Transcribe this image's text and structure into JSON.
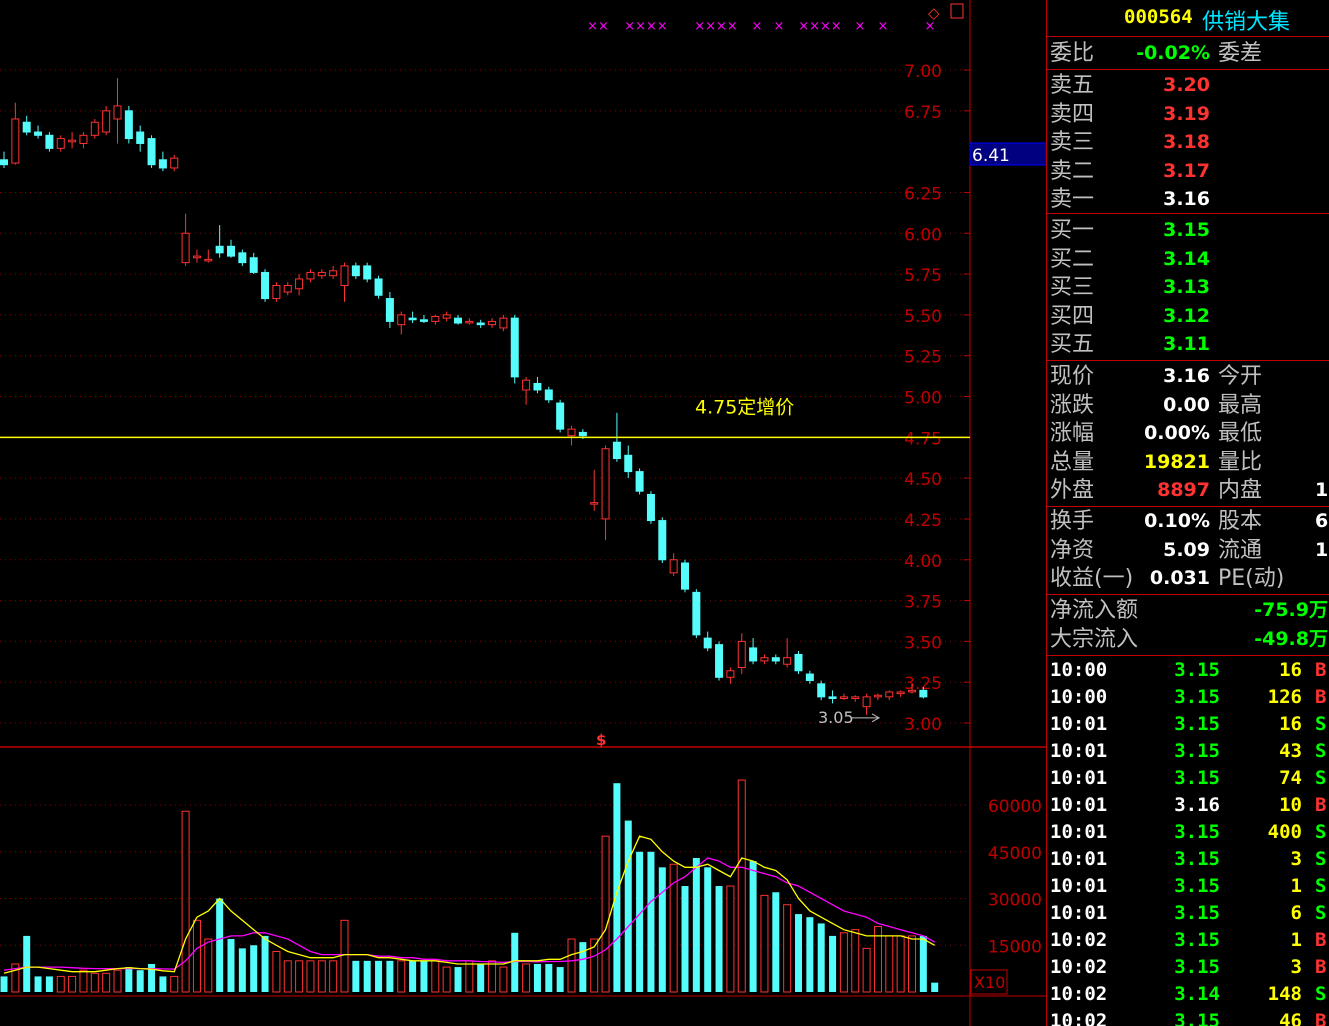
{
  "stock": {
    "code": "000564",
    "name": "供销大集"
  },
  "price_axis": [
    {
      "label": "7.00",
      "v": 7.0
    },
    {
      "label": "6.75",
      "v": 6.75
    },
    {
      "label": "6.25",
      "v": 6.25
    },
    {
      "label": "6.00",
      "v": 6.0
    },
    {
      "label": "5.75",
      "v": 5.75
    },
    {
      "label": "5.50",
      "v": 5.5
    },
    {
      "label": "5.25",
      "v": 5.25
    },
    {
      "label": "5.00",
      "v": 5.0
    },
    {
      "label": "4.75",
      "v": 4.75
    },
    {
      "label": "4.50",
      "v": 4.5
    },
    {
      "label": "4.25",
      "v": 4.25
    },
    {
      "label": "4.00",
      "v": 4.0
    },
    {
      "label": "3.75",
      "v": 3.75
    },
    {
      "label": "3.50",
      "v": 3.5
    },
    {
      "label": "3.25",
      "v": 3.25
    },
    {
      "label": "3.00",
      "v": 3.0
    }
  ],
  "current_price_tag": "6.41",
  "ref_line": {
    "label": "4.75定增价",
    "value": 4.75
  },
  "low_marker": "3.05",
  "dollar_marker": "$",
  "volume_axis": [
    {
      "label": "60000",
      "v": 60000
    },
    {
      "label": "45000",
      "v": 45000
    },
    {
      "label": "30000",
      "v": 30000
    },
    {
      "label": "15000",
      "v": 15000
    }
  ],
  "volume_unit": "X10",
  "top_markers": [
    "××",
    "××××",
    "××××",
    "×",
    "×",
    "××××",
    "×",
    "×",
    "×"
  ],
  "colors": {
    "up": "#ff3232",
    "down": "#54fcfc",
    "grid": "#8b0000",
    "ref": "#ffff00",
    "ma_yellow": "#ffff00",
    "ma_magenta": "#ff00ff"
  },
  "chart_data": [
    {
      "type": "candlestick",
      "title": "",
      "ylim": [
        3.0,
        7.0
      ],
      "candles": [
        {
          "o": 6.45,
          "h": 6.5,
          "l": 6.4,
          "c": 6.42
        },
        {
          "o": 6.43,
          "h": 6.8,
          "l": 6.42,
          "c": 6.7
        },
        {
          "o": 6.68,
          "h": 6.72,
          "l": 6.6,
          "c": 6.62
        },
        {
          "o": 6.62,
          "h": 6.66,
          "l": 6.58,
          "c": 6.6
        },
        {
          "o": 6.6,
          "h": 6.62,
          "l": 6.5,
          "c": 6.52
        },
        {
          "o": 6.52,
          "h": 6.6,
          "l": 6.5,
          "c": 6.58
        },
        {
          "o": 6.56,
          "h": 6.62,
          "l": 6.52,
          "c": 6.57
        },
        {
          "o": 6.55,
          "h": 6.62,
          "l": 6.52,
          "c": 6.6
        },
        {
          "o": 6.6,
          "h": 6.7,
          "l": 6.58,
          "c": 6.68
        },
        {
          "o": 6.62,
          "h": 6.78,
          "l": 6.6,
          "c": 6.75
        },
        {
          "o": 6.7,
          "h": 6.95,
          "l": 6.55,
          "c": 6.78
        },
        {
          "o": 6.75,
          "h": 6.78,
          "l": 6.55,
          "c": 6.58
        },
        {
          "o": 6.62,
          "h": 6.66,
          "l": 6.5,
          "c": 6.55
        },
        {
          "o": 6.58,
          "h": 6.6,
          "l": 6.4,
          "c": 6.42
        },
        {
          "o": 6.45,
          "h": 6.5,
          "l": 6.38,
          "c": 6.4
        },
        {
          "o": 6.4,
          "h": 6.48,
          "l": 6.38,
          "c": 6.46
        },
        {
          "o": 5.82,
          "h": 6.12,
          "l": 5.8,
          "c": 6.0
        },
        {
          "o": 5.85,
          "h": 5.9,
          "l": 5.82,
          "c": 5.86
        },
        {
          "o": 5.84,
          "h": 5.9,
          "l": 5.82,
          "c": 5.84
        },
        {
          "o": 5.92,
          "h": 6.05,
          "l": 5.85,
          "c": 5.88
        },
        {
          "o": 5.92,
          "h": 5.96,
          "l": 5.85,
          "c": 5.86
        },
        {
          "o": 5.88,
          "h": 5.9,
          "l": 5.8,
          "c": 5.82
        },
        {
          "o": 5.85,
          "h": 5.88,
          "l": 5.75,
          "c": 5.76
        },
        {
          "o": 5.76,
          "h": 5.78,
          "l": 5.58,
          "c": 5.6
        },
        {
          "o": 5.6,
          "h": 5.7,
          "l": 5.58,
          "c": 5.68
        },
        {
          "o": 5.64,
          "h": 5.7,
          "l": 5.62,
          "c": 5.68
        },
        {
          "o": 5.66,
          "h": 5.75,
          "l": 5.62,
          "c": 5.72
        },
        {
          "o": 5.72,
          "h": 5.78,
          "l": 5.7,
          "c": 5.76
        },
        {
          "o": 5.74,
          "h": 5.78,
          "l": 5.72,
          "c": 5.76
        },
        {
          "o": 5.74,
          "h": 5.8,
          "l": 5.72,
          "c": 5.77
        },
        {
          "o": 5.68,
          "h": 5.82,
          "l": 5.58,
          "c": 5.8
        },
        {
          "o": 5.8,
          "h": 5.82,
          "l": 5.72,
          "c": 5.74
        },
        {
          "o": 5.8,
          "h": 5.82,
          "l": 5.7,
          "c": 5.72
        },
        {
          "o": 5.72,
          "h": 5.74,
          "l": 5.6,
          "c": 5.62
        },
        {
          "o": 5.6,
          "h": 5.64,
          "l": 5.42,
          "c": 5.46
        },
        {
          "o": 5.44,
          "h": 5.52,
          "l": 5.38,
          "c": 5.5
        },
        {
          "o": 5.48,
          "h": 5.52,
          "l": 5.45,
          "c": 5.47
        },
        {
          "o": 5.47,
          "h": 5.5,
          "l": 5.45,
          "c": 5.46
        },
        {
          "o": 5.46,
          "h": 5.5,
          "l": 5.44,
          "c": 5.49
        },
        {
          "o": 5.48,
          "h": 5.52,
          "l": 5.46,
          "c": 5.5
        },
        {
          "o": 5.48,
          "h": 5.5,
          "l": 5.44,
          "c": 5.45
        },
        {
          "o": 5.46,
          "h": 5.48,
          "l": 5.44,
          "c": 5.46
        },
        {
          "o": 5.45,
          "h": 5.47,
          "l": 5.42,
          "c": 5.44
        },
        {
          "o": 5.44,
          "h": 5.48,
          "l": 5.42,
          "c": 5.46
        },
        {
          "o": 5.42,
          "h": 5.5,
          "l": 5.4,
          "c": 5.48
        },
        {
          "o": 5.48,
          "h": 5.5,
          "l": 5.08,
          "c": 5.12
        },
        {
          "o": 5.04,
          "h": 5.12,
          "l": 4.95,
          "c": 5.1
        },
        {
          "o": 5.08,
          "h": 5.12,
          "l": 5.02,
          "c": 5.04
        },
        {
          "o": 5.04,
          "h": 5.06,
          "l": 4.96,
          "c": 4.98
        },
        {
          "o": 4.96,
          "h": 4.98,
          "l": 4.78,
          "c": 4.8
        },
        {
          "o": 4.76,
          "h": 4.82,
          "l": 4.7,
          "c": 4.8
        },
        {
          "o": 4.78,
          "h": 4.8,
          "l": 4.74,
          "c": 4.76
        },
        {
          "o": 4.35,
          "h": 4.55,
          "l": 4.3,
          "c": 4.35
        },
        {
          "o": 4.25,
          "h": 4.7,
          "l": 4.12,
          "c": 4.68
        },
        {
          "o": 4.72,
          "h": 4.9,
          "l": 4.6,
          "c": 4.62
        },
        {
          "o": 4.64,
          "h": 4.7,
          "l": 4.5,
          "c": 4.54
        },
        {
          "o": 4.54,
          "h": 4.56,
          "l": 4.4,
          "c": 4.42
        },
        {
          "o": 4.4,
          "h": 4.42,
          "l": 4.22,
          "c": 4.24
        },
        {
          "o": 4.24,
          "h": 4.26,
          "l": 3.98,
          "c": 4.0
        },
        {
          "o": 3.92,
          "h": 4.04,
          "l": 3.9,
          "c": 4.0
        },
        {
          "o": 3.98,
          "h": 4.0,
          "l": 3.8,
          "c": 3.82
        },
        {
          "o": 3.8,
          "h": 3.82,
          "l": 3.52,
          "c": 3.54
        },
        {
          "o": 3.52,
          "h": 3.56,
          "l": 3.44,
          "c": 3.46
        },
        {
          "o": 3.48,
          "h": 3.5,
          "l": 3.26,
          "c": 3.28
        },
        {
          "o": 3.28,
          "h": 3.34,
          "l": 3.24,
          "c": 3.32
        },
        {
          "o": 3.34,
          "h": 3.55,
          "l": 3.3,
          "c": 3.5
        },
        {
          "o": 3.46,
          "h": 3.52,
          "l": 3.36,
          "c": 3.38
        },
        {
          "o": 3.38,
          "h": 3.42,
          "l": 3.36,
          "c": 3.4
        },
        {
          "o": 3.4,
          "h": 3.42,
          "l": 3.36,
          "c": 3.38
        },
        {
          "o": 3.36,
          "h": 3.52,
          "l": 3.34,
          "c": 3.4
        },
        {
          "o": 3.42,
          "h": 3.44,
          "l": 3.3,
          "c": 3.32
        },
        {
          "o": 3.3,
          "h": 3.32,
          "l": 3.24,
          "c": 3.26
        },
        {
          "o": 3.24,
          "h": 3.26,
          "l": 3.14,
          "c": 3.16
        },
        {
          "o": 3.16,
          "h": 3.2,
          "l": 3.12,
          "c": 3.15
        },
        {
          "o": 3.15,
          "h": 3.18,
          "l": 3.14,
          "c": 3.16
        },
        {
          "o": 3.15,
          "h": 3.17,
          "l": 3.13,
          "c": 3.16
        },
        {
          "o": 3.1,
          "h": 3.18,
          "l": 3.05,
          "c": 3.16
        },
        {
          "o": 3.16,
          "h": 3.18,
          "l": 3.14,
          "c": 3.17
        },
        {
          "o": 3.16,
          "h": 3.2,
          "l": 3.14,
          "c": 3.19
        },
        {
          "o": 3.18,
          "h": 3.2,
          "l": 3.16,
          "c": 3.19
        },
        {
          "o": 3.2,
          "h": 3.24,
          "l": 3.18,
          "c": 3.2
        },
        {
          "o": 3.2,
          "h": 3.22,
          "l": 3.15,
          "c": 3.16
        }
      ]
    },
    {
      "type": "bar",
      "title": "",
      "ylim": [
        0,
        70000
      ],
      "values": [
        5000,
        9000,
        18000,
        5000,
        5000,
        5000,
        5000,
        7000,
        6000,
        6000,
        7000,
        8000,
        7000,
        9000,
        5000,
        5000,
        58000,
        23000,
        17000,
        30000,
        17000,
        14000,
        15000,
        18000,
        13000,
        10000,
        10000,
        10000,
        10000,
        10000,
        23000,
        10000,
        10000,
        10000,
        10000,
        10000,
        10000,
        10000,
        10000,
        8000,
        8000,
        10000,
        9000,
        10000,
        8000,
        19000,
        9000,
        9000,
        9000,
        8000,
        17000,
        16000,
        17000,
        50000,
        67000,
        55000,
        45000,
        45000,
        40000,
        41000,
        34000,
        43000,
        40000,
        34000,
        34000,
        68000,
        42000,
        31000,
        32000,
        28000,
        25000,
        24000,
        22000,
        18000,
        19000,
        20000,
        14000,
        21000,
        18000,
        18000,
        18000,
        18000,
        3000
      ],
      "ma_short": [
        6000,
        7000,
        8000,
        8000,
        7500,
        7000,
        6500,
        6500,
        6500,
        7000,
        7500,
        7800,
        7500,
        7300,
        6800,
        6500,
        17000,
        24000,
        26000,
        30000,
        26000,
        23000,
        20000,
        17000,
        15000,
        13000,
        12000,
        11000,
        11000,
        11000,
        12000,
        12000,
        12000,
        11000,
        11000,
        10500,
        10000,
        10000,
        10000,
        9500,
        9000,
        9000,
        9000,
        9000,
        9000,
        10000,
        10000,
        10000,
        10500,
        10500,
        12000,
        13000,
        14500,
        20000,
        32000,
        42000,
        50000,
        49000,
        45000,
        42000,
        40000,
        40000,
        41000,
        39000,
        37000,
        43000,
        42000,
        40000,
        39000,
        36000,
        30000,
        26000,
        24000,
        22000,
        20000,
        19000,
        18000,
        18000,
        18000,
        18000,
        17000,
        17000,
        15000
      ],
      "ma_long": [
        7000,
        7500,
        8000,
        8000,
        8000,
        8000,
        7800,
        7600,
        7500,
        7500,
        7500,
        7500,
        7500,
        7500,
        7400,
        7300,
        10000,
        14000,
        16000,
        17000,
        18000,
        18000,
        19000,
        19000,
        18000,
        17000,
        15000,
        13000,
        12000,
        12000,
        12000,
        12000,
        12000,
        11500,
        11500,
        11000,
        11000,
        10500,
        10500,
        10000,
        10000,
        10000,
        9800,
        9700,
        9500,
        9800,
        9800,
        9700,
        9800,
        9800,
        10000,
        10500,
        11500,
        13500,
        17000,
        21000,
        25000,
        29000,
        32000,
        35000,
        37000,
        40000,
        43000,
        42000,
        40000,
        40000,
        39000,
        38000,
        37000,
        35000,
        34000,
        32000,
        30000,
        28000,
        26000,
        25000,
        24000,
        22000,
        21000,
        20000,
        19000,
        18000,
        16000
      ]
    }
  ],
  "panel": {
    "weibi": {
      "label": "委比",
      "value": "-0.02%",
      "label2": "委差"
    },
    "asks": [
      {
        "label": "卖五",
        "price": "3.20"
      },
      {
        "label": "卖四",
        "price": "3.19"
      },
      {
        "label": "卖三",
        "price": "3.18"
      },
      {
        "label": "卖二",
        "price": "3.17"
      },
      {
        "label": "卖一",
        "price": "3.16"
      }
    ],
    "bids": [
      {
        "label": "买一",
        "price": "3.15"
      },
      {
        "label": "买二",
        "price": "3.14"
      },
      {
        "label": "买三",
        "price": "3.13"
      },
      {
        "label": "买四",
        "price": "3.12"
      },
      {
        "label": "买五",
        "price": "3.11"
      }
    ],
    "quote": [
      {
        "label": "现价",
        "value": "3.16",
        "label2": "今开",
        "value2": ""
      },
      {
        "label": "涨跌",
        "value": "0.00",
        "label2": "最高",
        "value2": ""
      },
      {
        "label": "涨幅",
        "value": "0.00%",
        "label2": "最低",
        "value2": ""
      },
      {
        "label": "总量",
        "value": "19821",
        "label2": "量比",
        "value2": ""
      },
      {
        "label": "外盘",
        "value": "8897",
        "label2": "内盘",
        "value2": "1"
      }
    ],
    "fund": [
      {
        "label": "换手",
        "value": "0.10%",
        "label2": "股本",
        "value2": "6"
      },
      {
        "label": "净资",
        "value": "5.09",
        "label2": "流通",
        "value2": "1"
      },
      {
        "label": "收益(一)",
        "value": "0.031",
        "label2": "PE(动)",
        "value2": ""
      }
    ],
    "flow": [
      {
        "label": "净流入额",
        "value": "-75.9万"
      },
      {
        "label": "大宗流入",
        "value": "-49.8万"
      }
    ],
    "ticks": [
      {
        "time": "10:00",
        "price": "3.15",
        "vol": "16",
        "bs": "B"
      },
      {
        "time": "10:00",
        "price": "3.15",
        "vol": "126",
        "bs": "B"
      },
      {
        "time": "10:01",
        "price": "3.15",
        "vol": "16",
        "bs": "S"
      },
      {
        "time": "10:01",
        "price": "3.15",
        "vol": "43",
        "bs": "S"
      },
      {
        "time": "10:01",
        "price": "3.15",
        "vol": "74",
        "bs": "S"
      },
      {
        "time": "10:01",
        "price": "3.16",
        "vol": "10",
        "bs": "B"
      },
      {
        "time": "10:01",
        "price": "3.15",
        "vol": "400",
        "bs": "S"
      },
      {
        "time": "10:01",
        "price": "3.15",
        "vol": "3",
        "bs": "S"
      },
      {
        "time": "10:01",
        "price": "3.15",
        "vol": "1",
        "bs": "S"
      },
      {
        "time": "10:01",
        "price": "3.15",
        "vol": "6",
        "bs": "S"
      },
      {
        "time": "10:02",
        "price": "3.15",
        "vol": "1",
        "bs": "B"
      },
      {
        "time": "10:02",
        "price": "3.15",
        "vol": "3",
        "bs": "B"
      },
      {
        "time": "10:02",
        "price": "3.14",
        "vol": "148",
        "bs": "S"
      },
      {
        "time": "10:02",
        "price": "3.15",
        "vol": "46",
        "bs": "B"
      }
    ]
  }
}
